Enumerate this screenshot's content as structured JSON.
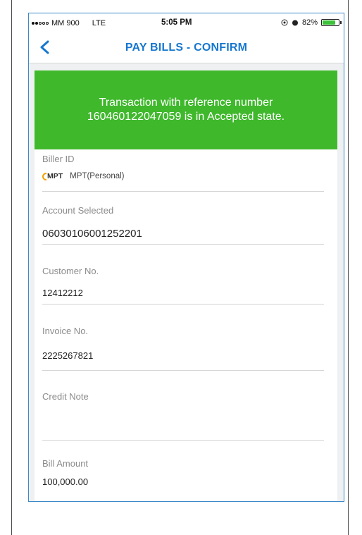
{
  "status_bar": {
    "carrier": "MM 900",
    "network": "LTE",
    "time": "5:05 PM",
    "battery_text": "82%",
    "battery_level": 0.82,
    "battery_color": "#3cc13b"
  },
  "nav": {
    "back_icon": "chevron-left-icon",
    "title": "PAY BILLS - CONFIRM"
  },
  "banner": {
    "line1": "Transaction with reference  number",
    "line2": "160460122047059 is in Accepted state.",
    "color": "#3fb82c"
  },
  "fields": {
    "biller": {
      "label": "Biller ID",
      "logo_text": "MPT",
      "value": "MPT(Personal)"
    },
    "account": {
      "label": "Account Selected",
      "value": "06030106001252201"
    },
    "customer": {
      "label": "Customer No.",
      "value": "12412212"
    },
    "invoice": {
      "label": "Invoice No.",
      "value": "2225267821"
    },
    "credit_note": {
      "label": "Credit Note",
      "value": ""
    },
    "bill_amount": {
      "label": "Bill Amount",
      "value": "100,000.00"
    }
  },
  "accent_color": "#1777cf"
}
